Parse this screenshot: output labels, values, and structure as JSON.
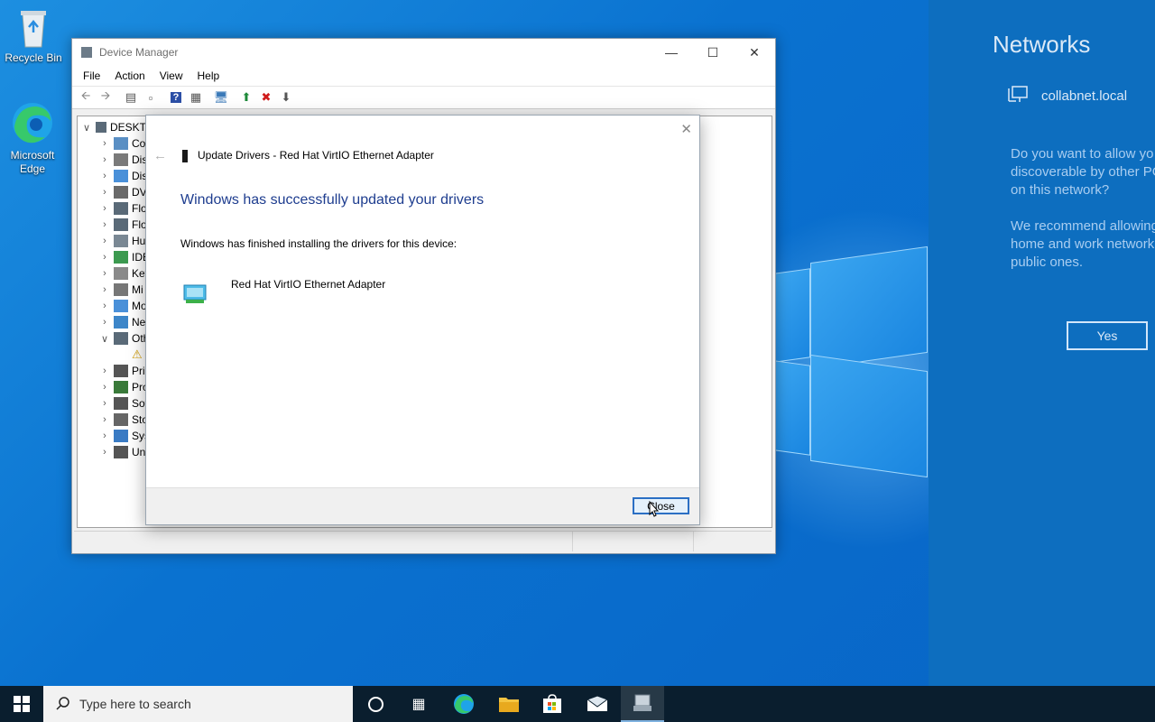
{
  "desktop": {
    "icons": [
      {
        "label": "Recycle Bin"
      },
      {
        "label": "Microsoft Edge"
      }
    ]
  },
  "device_manager": {
    "title": "Device Manager",
    "menu": [
      "File",
      "Action",
      "View",
      "Help"
    ],
    "tree": {
      "root": "DESKTC",
      "items": [
        {
          "label": "Co",
          "expanded": false
        },
        {
          "label": "Dis",
          "expanded": false
        },
        {
          "label": "Dis",
          "expanded": false
        },
        {
          "label": "DV",
          "expanded": false
        },
        {
          "label": "Flo",
          "expanded": false
        },
        {
          "label": "Flo",
          "expanded": false
        },
        {
          "label": "Hu",
          "expanded": false
        },
        {
          "label": "IDE",
          "expanded": false
        },
        {
          "label": "Key",
          "expanded": false
        },
        {
          "label": "Mi",
          "expanded": false
        },
        {
          "label": "Mo",
          "expanded": false
        },
        {
          "label": "Ne",
          "expanded": false
        },
        {
          "label": "Oth",
          "expanded": true
        },
        {
          "label": "Pri",
          "expanded": false
        },
        {
          "label": "Pro",
          "expanded": false
        },
        {
          "label": "Sof",
          "expanded": false
        },
        {
          "label": "Sto",
          "expanded": false
        },
        {
          "label": "Sys",
          "expanded": false
        },
        {
          "label": "Un",
          "expanded": false
        }
      ]
    }
  },
  "update_dialog": {
    "header": "Update Drivers - Red Hat VirtIO Ethernet Adapter",
    "headline": "Windows has successfully updated your drivers",
    "message": "Windows has finished installing the drivers for this device:",
    "device_name": "Red Hat VirtIO Ethernet Adapter",
    "close_button": "Close"
  },
  "networks_flyout": {
    "title": "Networks",
    "network_name": "collabnet.local",
    "question_lines": [
      "Do you want to allow yo",
      "discoverable by other PC",
      "on this network?"
    ],
    "recommend_lines": [
      "We recommend allowing",
      "home and work network",
      "public ones."
    ],
    "yes_button": "Yes"
  },
  "taskbar": {
    "search_placeholder": "Type here to search",
    "accent": "#0078d7"
  }
}
